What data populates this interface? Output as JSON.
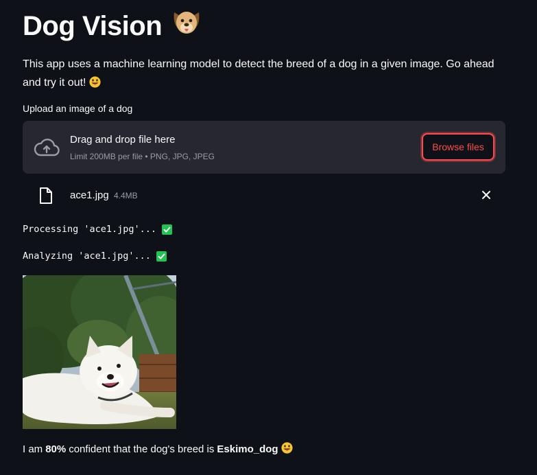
{
  "header": {
    "title": "Dog Vision",
    "title_emoji": "dog-face-icon"
  },
  "intro": {
    "text": "This app uses a machine learning model to detect the breed of a dog in a given image. Go ahead and try it out!",
    "emoji": "grinning-tongue-face-icon"
  },
  "uploader": {
    "label": "Upload an image of a dog",
    "instructions": "Drag and drop file here",
    "limit": "Limit 200MB per file • PNG, JPG, JPEG",
    "browse_label": "Browse files",
    "file": {
      "name": "ace1.jpg",
      "size": "4.4MB"
    }
  },
  "status": {
    "processing": "Processing 'ace1.jpg'...",
    "analyzing": "Analyzing 'ace1.jpg'..."
  },
  "result": {
    "prefix": "I am",
    "confidence": "80%",
    "middle": "confident that the dog's breed is",
    "breed": "Eskimo_dog",
    "emoji": "grinning-tongue-face-icon"
  },
  "colors": {
    "background": "#0e1117",
    "dropzone": "#262730",
    "accent": "#ff4b4b",
    "success": "#21c354"
  }
}
